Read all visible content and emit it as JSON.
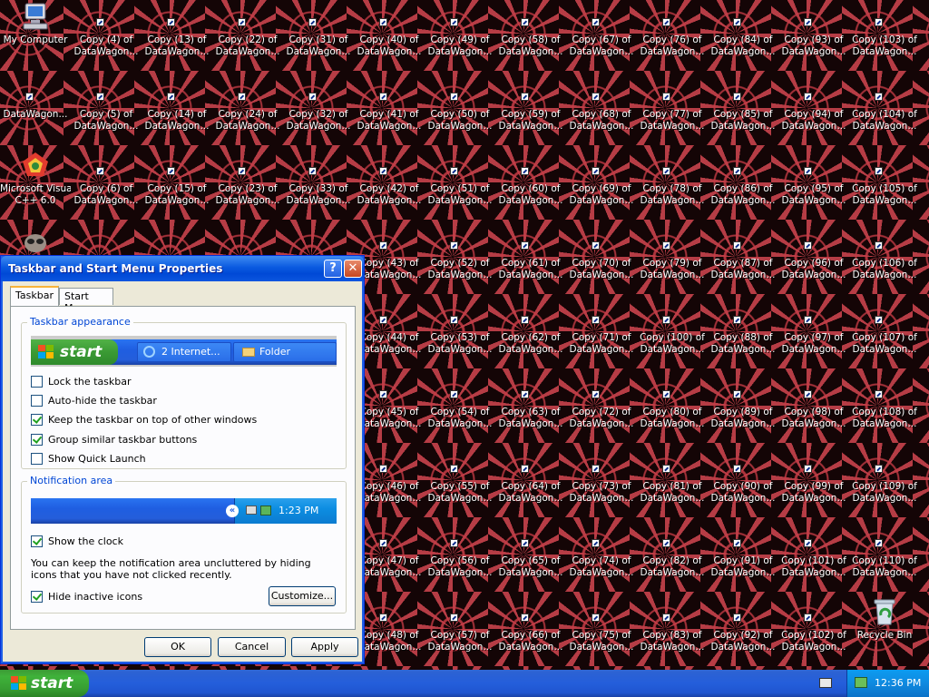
{
  "desktop": {
    "my_computer": "My Computer",
    "datawagon": "DataWagon...",
    "msvc_1": "Microsoft Visual",
    "msvc_2": "C++ 6.0",
    "recycle_bin": "Recycle Bin",
    "copy_line2": "DataWagon...",
    "copy_columns": [
      [
        "Copy (4) of",
        "Copy (5) of",
        "Copy (6) of"
      ],
      [
        "Copy (13) of",
        "Copy (14) of",
        "Copy (15) of"
      ],
      [
        "Copy (22) of",
        "Copy (24) of",
        "Copy (23) of"
      ],
      [
        "Copy (31) of",
        "Copy (32) of",
        "Copy (33) of"
      ],
      [
        "Copy (40) of",
        "Copy (41) of",
        "Copy (42) of",
        "Copy (43) of",
        "Copy (44) of",
        "Copy (45) of",
        "Copy (46) of",
        "Copy (47) of",
        "Copy (48) of"
      ],
      [
        "Copy (49) of",
        "Copy (50) of",
        "Copy (51) of",
        "Copy (52) of",
        "Copy (53) of",
        "Copy (54) of",
        "Copy (55) of",
        "Copy (56) of",
        "Copy (57) of"
      ],
      [
        "Copy (58) of",
        "Copy (59) of",
        "Copy (60) of",
        "Copy (61) of",
        "Copy (62) of",
        "Copy (63) of",
        "Copy (64) of",
        "Copy (65) of",
        "Copy (66) of"
      ],
      [
        "Copy (67) of",
        "Copy (68) of",
        "Copy (69) of",
        "Copy (70) of",
        "Copy (71) of",
        "Copy (72) of",
        "Copy (73) of",
        "Copy (74) of",
        "Copy (75) of"
      ],
      [
        "Copy (76) of",
        "Copy (77) of",
        "Copy (78) of",
        "Copy (79) of",
        "Copy (100) of",
        "Copy (80) of",
        "Copy (81) of",
        "Copy (82) of",
        "Copy (83) of"
      ],
      [
        "Copy (84) of",
        "Copy (85) of",
        "Copy (86) of",
        "Copy (87) of",
        "Copy (88) of",
        "Copy (89) of",
        "Copy (90) of",
        "Copy (91) of",
        "Copy (92) of"
      ],
      [
        "Copy (93) of",
        "Copy (94) of",
        "Copy (95) of",
        "Copy (96) of",
        "Copy (97) of",
        "Copy (98) of",
        "Copy (99) of",
        "Copy (101) of",
        "Copy (102) of"
      ],
      [
        "Copy (103) of",
        "Copy (104) of",
        "Copy (105) of",
        "Copy (106) of",
        "Copy (107) of",
        "Copy (108) of",
        "Copy (109) of",
        "Copy (110) of"
      ]
    ]
  },
  "dialog": {
    "title": "Taskbar and Start Menu Properties",
    "help_glyph": "?",
    "close_glyph": "✕",
    "tabs": [
      {
        "label": "Taskbar",
        "active": true
      },
      {
        "label": "Start Menu",
        "active": false
      }
    ],
    "appearance": {
      "title": "Taskbar appearance",
      "preview_start": "start",
      "preview_button_1": "2 Internet...",
      "preview_button_2": "Folder",
      "options": [
        {
          "label": "Lock the taskbar",
          "checked": false
        },
        {
          "label": "Auto-hide the taskbar",
          "checked": false
        },
        {
          "label": "Keep the taskbar on top of other windows",
          "checked": true
        },
        {
          "label": "Group similar taskbar buttons",
          "checked": true
        },
        {
          "label": "Show Quick Launch",
          "checked": false
        }
      ]
    },
    "notification": {
      "title": "Notification area",
      "preview_time": "1:23 PM",
      "show_clock": {
        "label": "Show the clock",
        "checked": true
      },
      "description": "You can keep the notification area uncluttered by hiding icons that you have not clicked recently.",
      "hide_inactive": {
        "label": "Hide inactive icons",
        "checked": true
      },
      "customize_label": "Customize..."
    },
    "buttons": {
      "ok": "OK",
      "cancel": "Cancel",
      "apply": "Apply"
    }
  },
  "taskbar": {
    "start_label": "start",
    "clock": "12:36 PM"
  }
}
